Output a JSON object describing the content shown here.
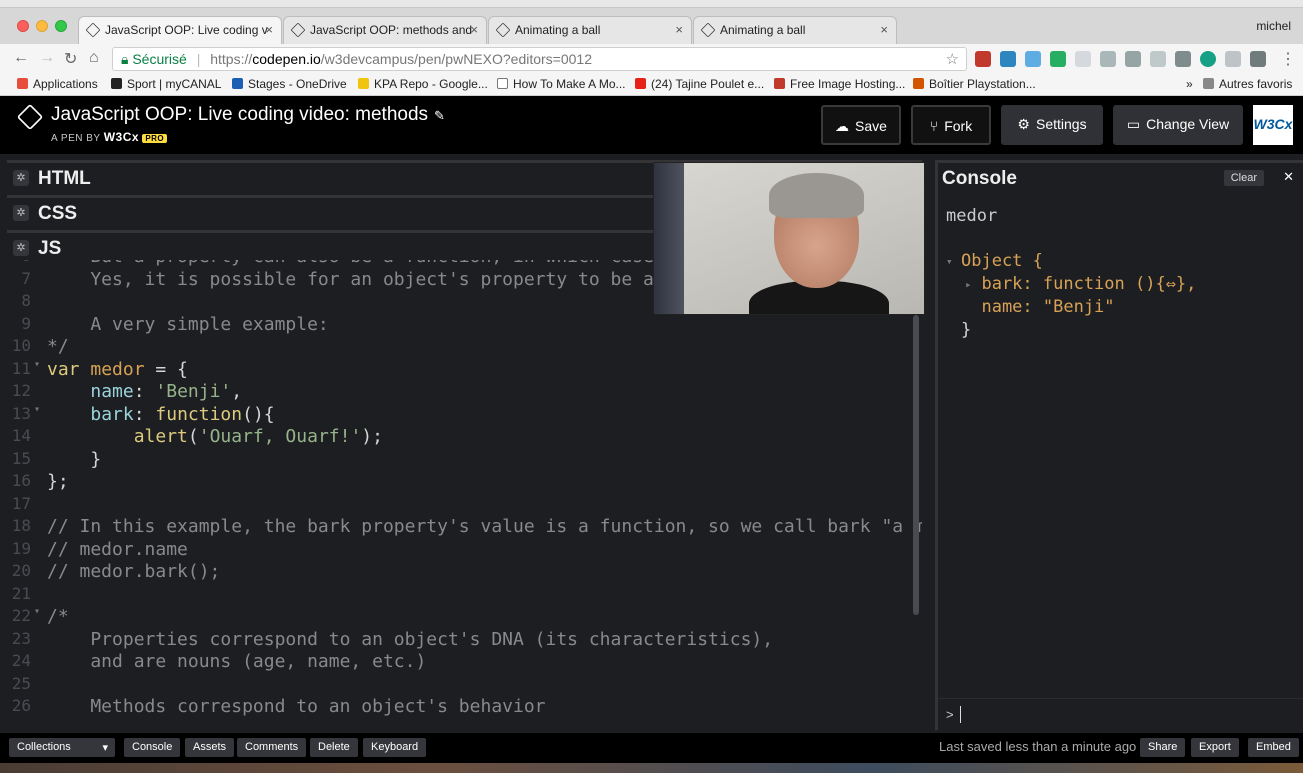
{
  "browser": {
    "tabs": [
      {
        "title": "JavaScript OOP: Live coding v",
        "active": true
      },
      {
        "title": "JavaScript OOP: methods and",
        "active": false
      },
      {
        "title": "Animating a ball",
        "active": false
      },
      {
        "title": "Animating a ball",
        "active": false
      }
    ],
    "tab_close_glyph": "×",
    "profile_name": "michel",
    "nav": {
      "back": "←",
      "forward": "→",
      "reload": "↻",
      "home": "⌂"
    },
    "address": {
      "secure_label": "Sécurisé",
      "url_scheme": "https://",
      "url_host": "codepen.io",
      "url_path": "/w3devcampus/pen/pwNEXO?editors=0012",
      "star_glyph": "☆"
    },
    "menu_glyph": "⋮",
    "bookmarks": [
      {
        "label": "Applications",
        "icon_color": "#e74c3c"
      },
      {
        "label": "Sport | myCANAL",
        "icon_color": "#222222"
      },
      {
        "label": "Stages - OneDrive",
        "icon_color": "#1a5fb4"
      },
      {
        "label": "KPA Repo - Google...",
        "icon_color": "#f1c40f"
      },
      {
        "label": "How To Make A Mo...",
        "icon_color": "#ffffff"
      },
      {
        "label": "(24) Tajine Poulet e...",
        "icon_color": "#e62117"
      },
      {
        "label": "Free Image Hosting...",
        "icon_color": "#c0392b"
      },
      {
        "label": "Boîtier Playstation...",
        "icon_color": "#d35400"
      }
    ],
    "bookmarks_more": "»",
    "other_bookmarks": "Autres favoris"
  },
  "pen": {
    "title": "JavaScript OOP: Live coding video: methods",
    "edit_glyph": "✎",
    "byline_prefix": "A PEN BY",
    "byline_author": "W3Cx",
    "pro_badge": "PRO",
    "buttons": {
      "save": "Save",
      "fork": "Fork",
      "settings": "Settings",
      "change_view": "Change View"
    },
    "w3c_badge": "W3Cx"
  },
  "editors": {
    "html_label": "HTML",
    "css_label": "CSS",
    "js_label": "JS",
    "gear_glyph": "✲"
  },
  "code_lines": [
    {
      "n": "6",
      "fold": "",
      "tokens": [
        {
          "t": "    But a property can also be a function, in which case it is",
          "c": "com"
        }
      ]
    },
    {
      "n": "7",
      "fold": "",
      "tokens": [
        {
          "t": "    Yes, it is possible for an object's property to be a funct",
          "c": "com"
        }
      ]
    },
    {
      "n": "8",
      "fold": "",
      "tokens": []
    },
    {
      "n": "9",
      "fold": "",
      "tokens": [
        {
          "t": "    A very simple example:",
          "c": "com"
        }
      ]
    },
    {
      "n": "10",
      "fold": "",
      "tokens": [
        {
          "t": "*/",
          "c": "com"
        }
      ]
    },
    {
      "n": "11",
      "fold": "▾",
      "tokens": [
        {
          "t": "var ",
          "c": "kw"
        },
        {
          "t": "medor",
          "c": "var"
        },
        {
          "t": " = {",
          "c": ""
        }
      ]
    },
    {
      "n": "12",
      "fold": "",
      "tokens": [
        {
          "t": "    ",
          "c": ""
        },
        {
          "t": "name",
          "c": "prop"
        },
        {
          "t": ": ",
          "c": ""
        },
        {
          "t": "'Benji'",
          "c": "str"
        },
        {
          "t": ",",
          "c": ""
        }
      ]
    },
    {
      "n": "13",
      "fold": "▾",
      "tokens": [
        {
          "t": "    ",
          "c": ""
        },
        {
          "t": "bark",
          "c": "prop"
        },
        {
          "t": ": ",
          "c": ""
        },
        {
          "t": "function",
          "c": "fn"
        },
        {
          "t": "(){",
          "c": ""
        }
      ]
    },
    {
      "n": "14",
      "fold": "",
      "tokens": [
        {
          "t": "        ",
          "c": ""
        },
        {
          "t": "alert",
          "c": "fn"
        },
        {
          "t": "(",
          "c": ""
        },
        {
          "t": "'Ouarf, Ouarf!'",
          "c": "str"
        },
        {
          "t": ");",
          "c": ""
        }
      ]
    },
    {
      "n": "15",
      "fold": "",
      "tokens": [
        {
          "t": "    }",
          "c": ""
        }
      ]
    },
    {
      "n": "16",
      "fold": "",
      "tokens": [
        {
          "t": "};",
          "c": ""
        }
      ]
    },
    {
      "n": "17",
      "fold": "",
      "tokens": []
    },
    {
      "n": "18",
      "fold": "",
      "tokens": [
        {
          "t": "// In this example, the bark property's value is a function, so we call bark \"a method\".",
          "c": "com"
        }
      ]
    },
    {
      "n": "19",
      "fold": "",
      "tokens": [
        {
          "t": "// medor.name",
          "c": "com"
        }
      ]
    },
    {
      "n": "20",
      "fold": "",
      "tokens": [
        {
          "t": "// medor.bark();",
          "c": "com"
        }
      ]
    },
    {
      "n": "21",
      "fold": "",
      "tokens": []
    },
    {
      "n": "22",
      "fold": "▾",
      "tokens": [
        {
          "t": "/*",
          "c": "com"
        }
      ]
    },
    {
      "n": "23",
      "fold": "",
      "tokens": [
        {
          "t": "    Properties correspond to an object's DNA (its characteristics),",
          "c": "com"
        }
      ]
    },
    {
      "n": "24",
      "fold": "",
      "tokens": [
        {
          "t": "    and are nouns (age, name, etc.)",
          "c": "com"
        }
      ]
    },
    {
      "n": "25",
      "fold": "",
      "tokens": []
    },
    {
      "n": "26",
      "fold": "",
      "tokens": [
        {
          "t": "    Methods correspond to an object's behavior",
          "c": "com"
        }
      ]
    }
  ],
  "console": {
    "title": "Console",
    "clear": "Clear",
    "close_glyph": "✕",
    "output_lines": [
      {
        "text": "medor",
        "indent": 0,
        "arrow": ""
      },
      {
        "text": "Object {",
        "indent": 0,
        "arrow": "▾"
      },
      {
        "text": "  bark: function (){⇔},",
        "indent": 0,
        "arrow": "▸"
      },
      {
        "text": "  name: \"Benji\"",
        "indent": 0,
        "arrow": ""
      },
      {
        "text": "}",
        "indent": 0,
        "arrow": ""
      }
    ],
    "prompt": ">"
  },
  "footer": {
    "collections": "Collections",
    "console": "Console",
    "assets": "Assets",
    "comments": "Comments",
    "delete": "Delete",
    "keyboard": "Keyboard",
    "saved_text": "Last saved less than a minute ago",
    "share": "Share",
    "export": "Export",
    "embed": "Embed"
  },
  "colors": {
    "comment": "#88898d",
    "keyword": "#ddca7e",
    "variable": "#d7a254",
    "property": "#9ad3dc",
    "string": "#96b38a"
  }
}
